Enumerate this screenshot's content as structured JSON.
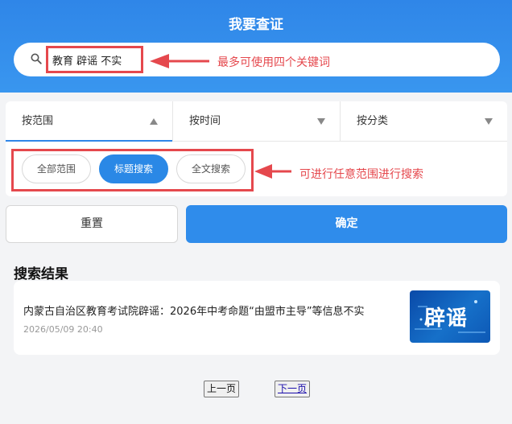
{
  "header": {
    "title": "我要查证"
  },
  "search": {
    "value": "教育 辟谣 不实"
  },
  "annotations": {
    "search_note": "最多可使用四个关键词",
    "scope_note": "可进行任意范围进行搜索",
    "color": "#e5484d"
  },
  "filters": {
    "tabs": [
      {
        "label": "按范围",
        "caret": "up",
        "active": true
      },
      {
        "label": "按时间",
        "caret": "down",
        "active": false
      },
      {
        "label": "按分类",
        "caret": "down",
        "active": false
      }
    ],
    "scopes": [
      {
        "label": "全部范围",
        "selected": false
      },
      {
        "label": "标题搜索",
        "selected": true
      },
      {
        "label": "全文搜索",
        "selected": false
      }
    ]
  },
  "actions": {
    "reset_label": "重置",
    "confirm_label": "确定"
  },
  "results": {
    "heading": "搜索结果",
    "items": [
      {
        "title": "内蒙古自治区教育考试院辟谣：2026年中考命题“由盟市主导”等信息不实",
        "date": "2026/05/09 20:40",
        "thumb_text": "辟谣"
      }
    ]
  },
  "pagination": {
    "prev_label": "上一页",
    "next_label": "下一页"
  },
  "colors": {
    "accent": "#2f86e8",
    "annotation": "#e5484d"
  }
}
